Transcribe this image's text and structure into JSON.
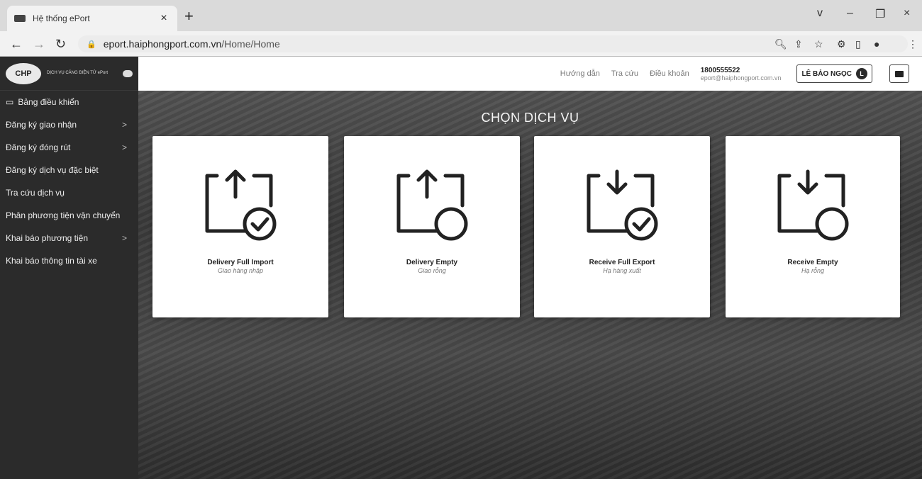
{
  "browser": {
    "tab_title": "Hệ thống ePort",
    "tab_close": "×",
    "new_tab": "+",
    "url_host_bold": "eport.haiphongport.com.vn",
    "url_path": "/Home/Home",
    "window_controls": [
      "v",
      "–",
      "❐",
      "×"
    ]
  },
  "sidebar": {
    "logo_text": "CHP",
    "brand_text": "DỊCH VỤ CẢNG ĐIỆN TỬ ePort",
    "items": [
      {
        "label": "Bảng điều khiển",
        "chevron": ""
      },
      {
        "label": "Đăng ký giao nhận",
        "chevron": ">"
      },
      {
        "label": "Đăng ký đóng rút",
        "chevron": ">"
      },
      {
        "label": "Đăng ký dịch vụ đặc biệt",
        "chevron": ""
      },
      {
        "label": "Tra cứu dịch vụ",
        "chevron": ""
      },
      {
        "label": "Phân phương tiện vận chuyển",
        "chevron": ""
      },
      {
        "label": "Khai báo phương tiện",
        "chevron": ">"
      },
      {
        "label": "Khai báo thông tin tài xe",
        "chevron": ""
      }
    ]
  },
  "header": {
    "links": [
      "Hướng dẫn",
      "Tra cứu",
      "Điều khoản"
    ],
    "phone": "1800555522",
    "email": "eport@haiphongport.com.vn",
    "user_name": "LÊ BẢO NGỌC",
    "user_initial": "L"
  },
  "main": {
    "heading": "CHỌN DỊCH VỤ",
    "cards": [
      {
        "title": "Delivery Full Import",
        "subtitle": "Giao hàng nhập",
        "arrow": "up",
        "check": true
      },
      {
        "title": "Delivery Empty",
        "subtitle": "Giao rỗng",
        "arrow": "up",
        "check": false
      },
      {
        "title": "Receive Full Export",
        "subtitle": "Hạ hàng xuất",
        "arrow": "down",
        "check": true
      },
      {
        "title": "Receive Empty",
        "subtitle": "Hạ rỗng",
        "arrow": "down",
        "check": false
      }
    ]
  }
}
